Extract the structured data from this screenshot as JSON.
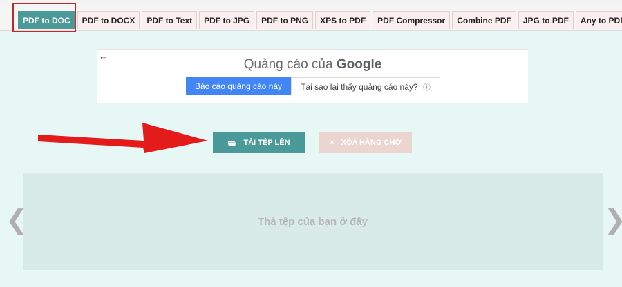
{
  "tabs": [
    {
      "label": "PDF to DOC",
      "active": true
    },
    {
      "label": "PDF to DOCX",
      "active": false
    },
    {
      "label": "PDF to Text",
      "active": false
    },
    {
      "label": "PDF to JPG",
      "active": false
    },
    {
      "label": "PDF to PNG",
      "active": false
    },
    {
      "label": "XPS to PDF",
      "active": false
    },
    {
      "label": "PDF Compressor",
      "active": false
    },
    {
      "label": "Combine PDF",
      "active": false
    },
    {
      "label": "JPG to PDF",
      "active": false
    },
    {
      "label": "Any to PDF",
      "active": false
    }
  ],
  "ad": {
    "back_icon": "←",
    "title_prefix": "Quảng cáo của",
    "title_brand": "Google",
    "report_label": "Báo cáo quảng cáo này",
    "why_label": "Tại sao lại thấy quảng cáo này?",
    "info_icon": "ⓘ"
  },
  "actions": {
    "upload_label": "TẢI TỆP LÊN",
    "clear_label": "XÓA HÀNG CHỜ"
  },
  "dropzone": {
    "text": "Thả tệp của bạn ở đây"
  },
  "colors": {
    "accent": "#4a9a99",
    "highlight": "#c62828",
    "arrow": "#e31b1b",
    "background": "#e6f7f6"
  }
}
